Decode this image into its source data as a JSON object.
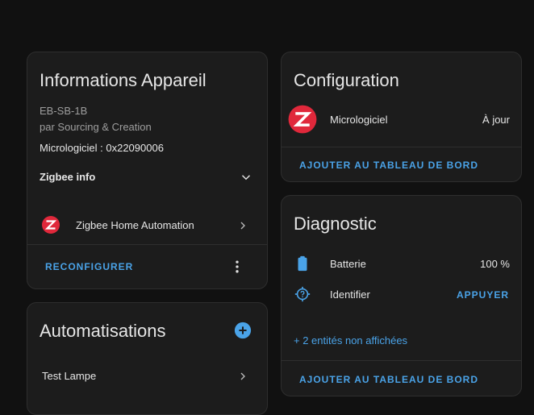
{
  "device_info": {
    "title": "Informations Appareil",
    "model": "EB-SB-1B",
    "manufacturer": "par Sourcing & Creation",
    "firmware": "Micrologiciel : 0x22090006",
    "zigbee_info_label": "Zigbee info",
    "integration_label": "Zigbee Home Automation",
    "reconfigure_label": "RECONFIGURER"
  },
  "automations": {
    "title": "Automatisations",
    "items": [
      {
        "label": "Test Lampe"
      }
    ]
  },
  "configuration": {
    "title": "Configuration",
    "firmware_label": "Micrologiciel",
    "firmware_status": "À jour",
    "add_dashboard_label": "AJOUTER AU TABLEAU DE BORD"
  },
  "diagnostic": {
    "title": "Diagnostic",
    "battery_label": "Batterie",
    "battery_value": "100 %",
    "identify_label": "Identifier",
    "identify_action": "APPUYER",
    "hidden_entities": "+ 2 entités non affichées",
    "add_dashboard_label": "AJOUTER AU TABLEAU DE BORD"
  },
  "colors": {
    "accent": "#4aa3e8",
    "zigbee_red": "#e0283b",
    "card_bg": "#1c1c1c",
    "page_bg": "#111111"
  }
}
